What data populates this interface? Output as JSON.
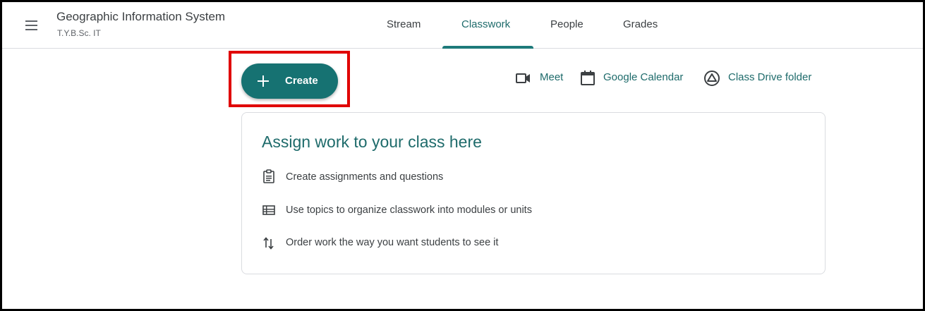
{
  "header": {
    "class_title": "Geographic Information System",
    "class_subtitle": "T.Y.B.Sc. IT",
    "menu_icon": "hamburger-menu-icon"
  },
  "tabs": [
    {
      "label": "Stream",
      "active": false
    },
    {
      "label": "Classwork",
      "active": true
    },
    {
      "label": "People",
      "active": false
    },
    {
      "label": "Grades",
      "active": false
    }
  ],
  "toolbar": {
    "create_label": "Create",
    "create_icon": "plus-icon",
    "links": [
      {
        "label": "Meet",
        "icon": "video-camera-icon"
      },
      {
        "label": "Google Calendar",
        "icon": "calendar-icon"
      },
      {
        "label": "Class Drive folder",
        "icon": "drive-icon"
      }
    ]
  },
  "card": {
    "title": "Assign work to your class here",
    "tips": [
      {
        "text": "Create assignments and questions",
        "icon": "assignment-icon"
      },
      {
        "text": "Use topics to organize classwork into modules or units",
        "icon": "topic-list-icon"
      },
      {
        "text": "Order work the way you want students to see it",
        "icon": "reorder-arrows-icon"
      }
    ]
  },
  "colors": {
    "accent": "#1e6b6b",
    "create_button": "#167272",
    "highlight": "#e00000",
    "border": "#dadce0"
  }
}
